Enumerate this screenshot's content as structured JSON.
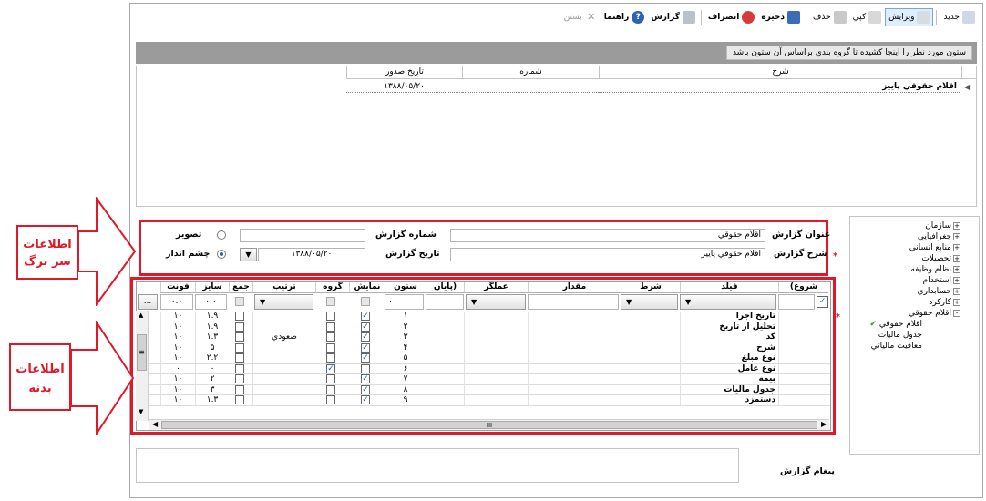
{
  "toolbar": {
    "items": [
      {
        "label": "جدید",
        "icon": "new-icon"
      },
      {
        "label": "ويرايش",
        "icon": "edit-icon",
        "active": true
      },
      {
        "label": "کپي",
        "icon": "copy-icon"
      },
      {
        "label": "حذف",
        "icon": "delete-icon"
      },
      {
        "label": "ذخيره",
        "icon": "save-icon"
      },
      {
        "label": "انصراف",
        "icon": "cancel-icon"
      },
      {
        "label": "گزارش",
        "icon": "print-icon"
      },
      {
        "label": "راهنما",
        "icon": "help-icon"
      },
      {
        "label": "بستن",
        "icon": "close-icon",
        "disabled": true
      }
    ]
  },
  "grouping": {
    "hint": "ستون مورد نظر را اينجا کشيده تا گروه بندي براساس آن ستون باشد"
  },
  "top_grid": {
    "columns": [
      "شرح",
      "شماره",
      "تاريخ صدور"
    ],
    "rows": [
      {
        "desc": "اقلام حقوقي پاييز",
        "number": "",
        "date": "۱۳۸۸/۰۵/۲۰"
      }
    ]
  },
  "header_panel": {
    "title_label": "عنوان گزارش",
    "title_value": "اقلام حقوقي",
    "number_label": "شماره گزارش",
    "number_value": "",
    "desc_label": "شرح گزارش",
    "desc_value": "اقلام حقوقي پاييز",
    "date_label": "تاريخ گزارش",
    "date_value": "۱۳۸۸/۰۵/۲۰",
    "radio_image": "تصوير",
    "radio_landscape": "چشم انداز",
    "required_mark": "*"
  },
  "body_grid": {
    "headers": [
      "(شروع",
      "فيلد",
      "شرط",
      "مقدار",
      "عملگر",
      "پايان)",
      "ستون",
      "نمايش",
      "گروه",
      "ترتيب",
      "جمع",
      "سايز",
      "فونت"
    ],
    "filter_values": {
      "column": "۰",
      "size": "۰.۰",
      "font": "۰.۰"
    },
    "more_button": "...",
    "rows": [
      {
        "field": "تاريخ اجرا",
        "col": "۱",
        "show": true,
        "group": false,
        "sort": "",
        "sum": false,
        "size": "۱.۹",
        "font": "۱۰"
      },
      {
        "field": "تحليل از تاريخ",
        "col": "۲",
        "show": true,
        "group": false,
        "sort": "",
        "sum": false,
        "size": "۱.۹",
        "font": "۱۰"
      },
      {
        "field": "کد",
        "col": "۳",
        "show": true,
        "group": false,
        "sort": "صعودي",
        "sum": false,
        "size": "۱.۳",
        "font": "۱۰"
      },
      {
        "field": "شرح",
        "col": "۴",
        "show": true,
        "group": false,
        "sort": "",
        "sum": false,
        "size": "۵",
        "font": "۱۰"
      },
      {
        "field": "نوع مبلغ",
        "col": "۵",
        "show": true,
        "group": false,
        "sort": "",
        "sum": false,
        "size": "۲.۲",
        "font": "۱۰"
      },
      {
        "field": "نوع عامل",
        "col": "۶",
        "show": false,
        "group": true,
        "sort": "",
        "sum": false,
        "size": "۰",
        "font": "۰"
      },
      {
        "field": "بيمه",
        "col": "۷",
        "show": true,
        "group": false,
        "sort": "",
        "sum": false,
        "size": "۲",
        "font": "۱۰"
      },
      {
        "field": "جدول ماليات",
        "col": "۸",
        "show": true,
        "group": false,
        "sort": "",
        "sum": false,
        "size": "۳",
        "font": "۱۰"
      },
      {
        "field": "دستمزد",
        "col": "۹",
        "show": true,
        "group": false,
        "sort": "",
        "sum": false,
        "size": "۱.۳",
        "font": "۱۰"
      }
    ],
    "hscroll_thumb": "III",
    "vscroll_thumb": "≡"
  },
  "message": {
    "label": "پيغام گزارش"
  },
  "tree": {
    "items": [
      {
        "label": "سازمان",
        "sign": "+",
        "level": 0
      },
      {
        "label": "جغرافيايي",
        "sign": "+",
        "level": 0
      },
      {
        "label": "منابع انساني",
        "sign": "+",
        "level": 0
      },
      {
        "label": "تحصيلات",
        "sign": "+",
        "level": 0
      },
      {
        "label": "نظام وظيفه",
        "sign": "+",
        "level": 0
      },
      {
        "label": "استخدام",
        "sign": "+",
        "level": 0
      },
      {
        "label": "حسابداري",
        "sign": "+",
        "level": 0
      },
      {
        "label": "کارکرد",
        "sign": "+",
        "level": 0
      },
      {
        "label": "اقلام حقوقي",
        "sign": "-",
        "level": 0
      },
      {
        "label": "اقلام حقوقي",
        "sign": "",
        "level": 1,
        "checked": true
      },
      {
        "label": "جدول ماليات",
        "sign": "",
        "level": 1
      },
      {
        "label": "معافيت مالياتي",
        "sign": "",
        "level": 1
      }
    ]
  },
  "callouts": {
    "header_info": "اطلاعات سر برگ",
    "body_info": "اطلاعات بدنه"
  },
  "colors": {
    "accent": "#e0192a",
    "group_bar": "#9b9b9b",
    "check": "#1d5fb8"
  }
}
